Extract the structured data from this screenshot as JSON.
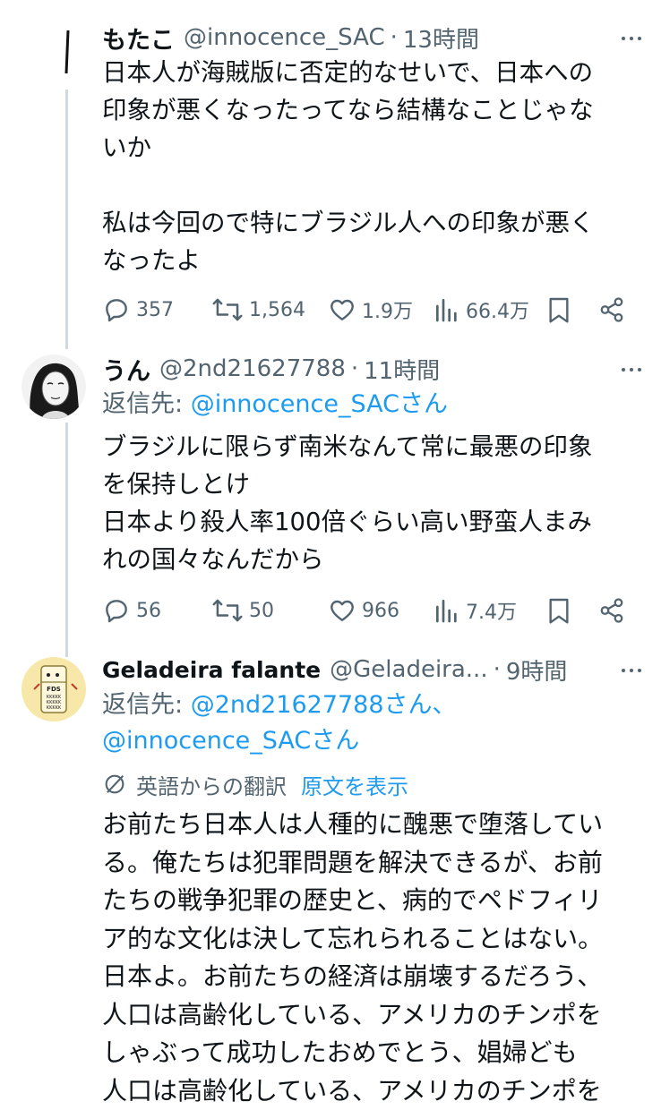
{
  "tweets": [
    {
      "name": "もたこ",
      "handle": "@innocence_SAC",
      "separator": "·",
      "time": "13時間",
      "text": "日本人が海賊版に否定的なせいで、日本への\n印象が悪くなったってなら結構なことじゃな\nいか\n\n私は今回ので特にブラジル人への印象が悪く\nなったよ",
      "stats": {
        "replies": "357",
        "retweets": "1,564",
        "likes": "1.9万",
        "views": "66.4万"
      }
    },
    {
      "name": "うん",
      "handle": "@2nd21627788",
      "separator": "·",
      "time": "11時間",
      "reply_prefix": "返信先: ",
      "reply_targets": "@innocence_SACさん",
      "text": "ブラジルに限らず南米なんて常に最悪の印象\nを保持しとけ\n日本より殺人率100倍ぐらい高い野蛮人まみ\nれの国々なんだから",
      "stats": {
        "replies": "56",
        "retweets": "50",
        "likes": "966",
        "views": "7.4万"
      }
    },
    {
      "name": "Geladeira falante",
      "handle": "@Geladeira...",
      "separator": "·",
      "time": "9時間",
      "reply_prefix": "返信先: ",
      "reply_targets_line1": "@2nd21627788さん、",
      "reply_targets_line2": "@innocence_SACさん",
      "translation_note": "英語からの翻訳",
      "show_original": "原文を表示",
      "avatar_text": "FDS",
      "avatar_lines": "KKKKK",
      "text": "お前たち日本人は人種的に醜悪で堕落してい\nる。俺たちは犯罪問題を解決できるが、お前\nたちの戦争犯罪の歴史と、病的でペドフィリ\nア的な文化は決して忘れられることはない。\n日本よ。お前たちの経済は崩壊するだろう、\n人口は高齢化している、アメリカのチンポを\nしゃぶって成功したおめでとう、娼婦ども\n人口は高齢化している、アメリカのチンポを"
    }
  ],
  "colors": {
    "text": "#0f1419",
    "secondary": "#536471",
    "link": "#1d9bf0",
    "thread": "#cfd9de"
  },
  "icons": [
    "reply-icon",
    "retweet-icon",
    "like-icon",
    "views-icon",
    "bookmark-icon",
    "share-icon",
    "more-icon",
    "translate-icon"
  ]
}
